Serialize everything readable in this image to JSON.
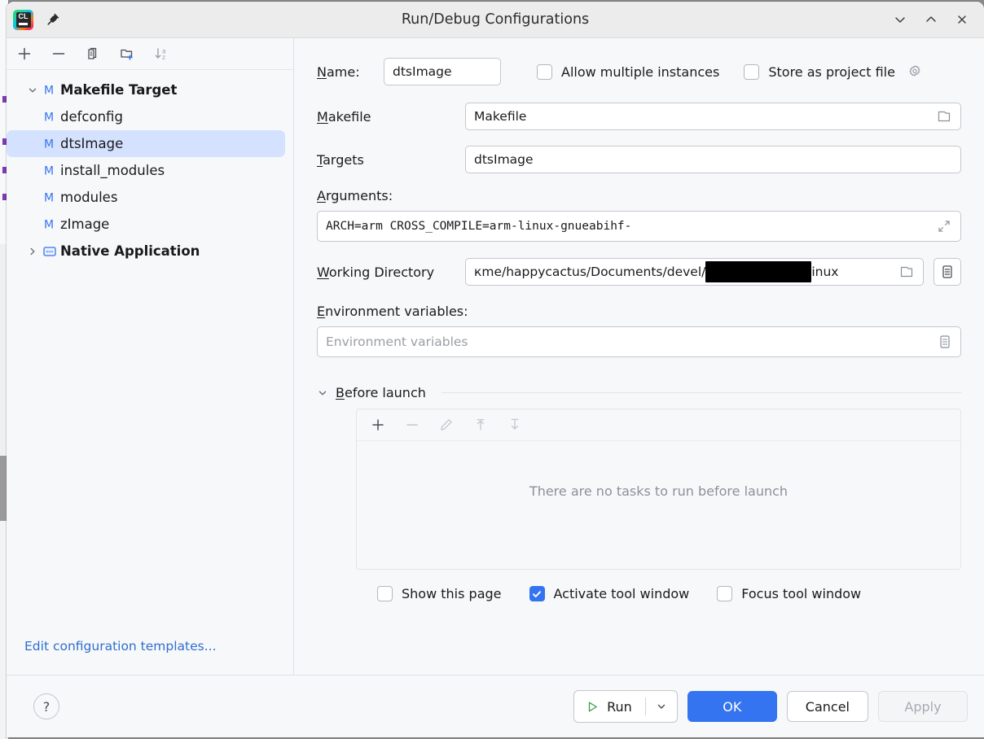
{
  "window": {
    "title": "Run/Debug Configurations",
    "app_icon": "clion-logo-icon",
    "app_icon_text": "CL",
    "pin_icon": "pin-icon",
    "controls": [
      {
        "name": "minimize-button",
        "icon": "chevron-down-icon"
      },
      {
        "name": "maximize-button",
        "icon": "chevron-up-icon"
      },
      {
        "name": "close-button",
        "icon": "close-icon"
      }
    ]
  },
  "sidebar": {
    "toolbar": [
      {
        "name": "add-configuration-button",
        "icon": "plus-icon"
      },
      {
        "name": "remove-configuration-button",
        "icon": "minus-icon"
      },
      {
        "name": "copy-configuration-button",
        "icon": "copy-icon"
      },
      {
        "name": "new-folder-button",
        "icon": "new-folder-icon"
      },
      {
        "name": "sort-configurations-button",
        "icon": "sort-alphabetical-icon"
      }
    ],
    "tree": [
      {
        "label": "Makefile Target",
        "icon": "makefile-icon",
        "level": 0,
        "expanded": true,
        "selected": false
      },
      {
        "label": "defconfig",
        "icon": "makefile-icon",
        "level": 1,
        "selected": false
      },
      {
        "label": "dtsImage",
        "icon": "makefile-icon",
        "level": 1,
        "selected": true
      },
      {
        "label": "install_modules",
        "icon": "makefile-icon",
        "level": 1,
        "selected": false
      },
      {
        "label": "modules",
        "icon": "makefile-icon",
        "level": 1,
        "selected": false
      },
      {
        "label": "zImage",
        "icon": "makefile-icon",
        "level": 1,
        "selected": false
      },
      {
        "label": "Native Application",
        "icon": "native-app-icon",
        "level": 0,
        "expanded": false,
        "selected": false
      }
    ],
    "edit_templates_link": "Edit configuration templates..."
  },
  "form": {
    "name_label": "Name:",
    "name_label_mnemonic": "N",
    "name_value": "dtsImage",
    "allow_multiple_instances_label": "Allow multiple instances",
    "allow_multiple_instances_checked": false,
    "store_as_project_file_label": "Store as project file",
    "store_as_project_file_checked": false,
    "store_gear_icon": "gear-icon",
    "makefile_label": "Makefile",
    "makefile_label_mnemonic": "M",
    "makefile_value": "Makefile",
    "makefile_browse_icon": "folder-icon",
    "targets_label": "Targets",
    "targets_label_mnemonic": "T",
    "targets_value": "dtsImage",
    "arguments_label": "Arguments:",
    "arguments_label_mnemonic": "A",
    "arguments_value": "ARCH=arm CROSS_COMPILE=arm-linux-gnueabihf-",
    "arguments_expand_icon": "expand-diagonal-icon",
    "working_directory_label": "Working Directory",
    "working_directory_label_mnemonic": "W",
    "working_directory_prefix": "кme/happycactus/Documents/devel/",
    "working_directory_redacted": true,
    "working_directory_suffix": "inux",
    "working_directory_browse_icon": "folder-icon",
    "working_directory_macro_icon": "list-icon",
    "environment_variables_label": "Environment variables:",
    "environment_variables_label_mnemonic": "E",
    "environment_variables_value": "",
    "environment_variables_placeholder": "Environment variables",
    "environment_variables_edit_icon": "list-icon"
  },
  "before_launch": {
    "title": "Before launch",
    "title_mnemonic": "B",
    "collapse_icon": "chevron-down-icon",
    "toolbar": [
      {
        "name": "add-task-button",
        "icon": "plus-icon",
        "enabled": true
      },
      {
        "name": "remove-task-button",
        "icon": "minus-icon",
        "enabled": false
      },
      {
        "name": "edit-task-button",
        "icon": "pencil-icon",
        "enabled": false
      },
      {
        "name": "move-task-up-button",
        "icon": "arrow-up-icon",
        "enabled": false
      },
      {
        "name": "move-task-down-button",
        "icon": "arrow-down-icon",
        "enabled": false
      }
    ],
    "empty_text": "There are no tasks to run before launch",
    "options": [
      {
        "label": "Show this page",
        "checked": false,
        "name": "show-this-page-checkbox"
      },
      {
        "label": "Activate tool window",
        "checked": true,
        "name": "activate-tool-window-checkbox"
      },
      {
        "label": "Focus tool window",
        "checked": false,
        "name": "focus-tool-window-checkbox"
      }
    ]
  },
  "footer": {
    "help_label": "?",
    "run_label": "Run",
    "run_icon": "play-icon",
    "run_dropdown_icon": "chevron-down-icon",
    "ok_label": "OK",
    "cancel_label": "Cancel",
    "apply_label": "Apply",
    "apply_disabled": true
  },
  "colors": {
    "accent": "#3574f0",
    "selection": "#d4e2ff",
    "link": "#2f6ecf",
    "panel": "#f7f8fa",
    "titlebar": "#ececec",
    "run_green": "#3f9e4a"
  }
}
